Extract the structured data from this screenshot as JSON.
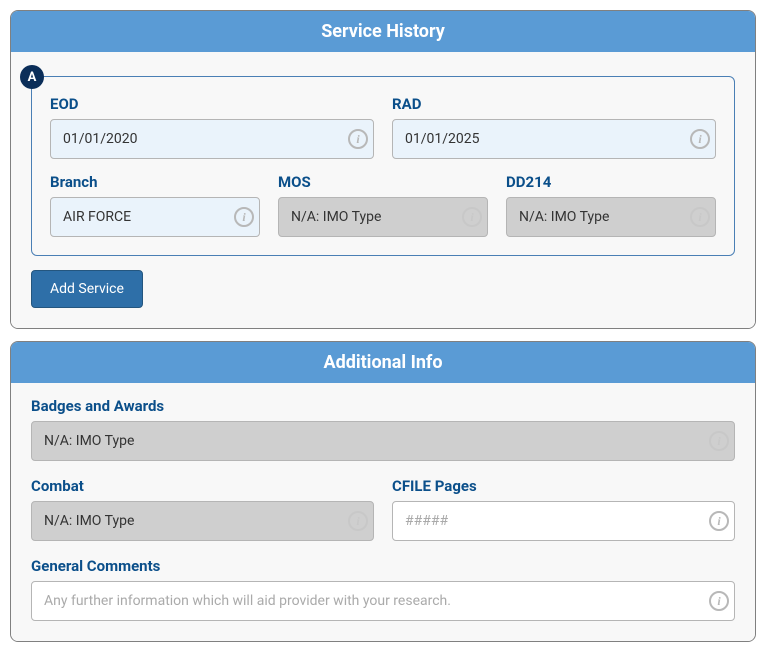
{
  "serviceHistory": {
    "title": "Service History",
    "badge": "A",
    "eod": {
      "label": "EOD",
      "value": "01/01/2020"
    },
    "rad": {
      "label": "RAD",
      "value": "01/01/2025"
    },
    "branch": {
      "label": "Branch",
      "value": "AIR FORCE"
    },
    "mos": {
      "label": "MOS",
      "value": "N/A: IMO Type"
    },
    "dd214": {
      "label": "DD214",
      "value": "N/A: IMO Type"
    },
    "addButton": "Add Service"
  },
  "additionalInfo": {
    "title": "Additional Info",
    "badgesAwards": {
      "label": "Badges and Awards",
      "value": "N/A: IMO Type"
    },
    "combat": {
      "label": "Combat",
      "value": "N/A: IMO Type"
    },
    "cfilePages": {
      "label": "CFILE Pages",
      "placeholder": "#####",
      "value": ""
    },
    "generalComments": {
      "label": "General Comments",
      "placeholder": "Any further information which will aid provider with your research.",
      "value": ""
    }
  }
}
